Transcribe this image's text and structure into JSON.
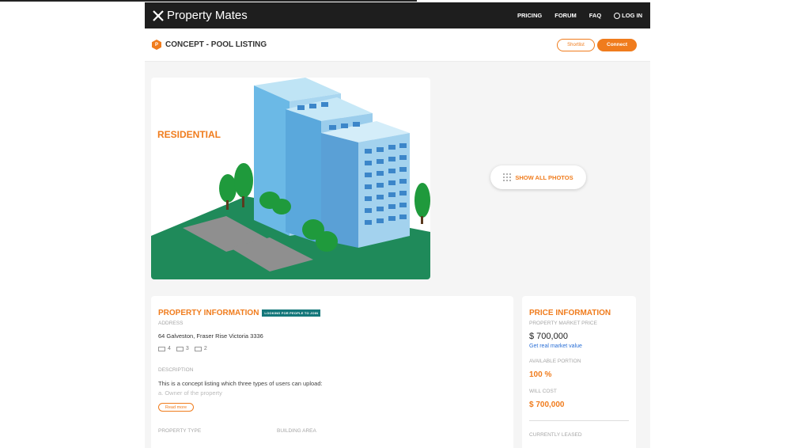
{
  "brand": {
    "name": "Property Mates"
  },
  "nav": {
    "pricing": "PRICING",
    "forum": "FORUM",
    "faq": "FAQ",
    "login": "LOG IN"
  },
  "listing": {
    "hex_letter": "P",
    "title": "CONCEPT - POOL LISTING"
  },
  "actions": {
    "shortlist": "Shortlist",
    "connect": "Connect"
  },
  "photo": {
    "label": "RESIDENTIAL"
  },
  "gallery": {
    "show_all": "SHOW ALL PHOTOS"
  },
  "property": {
    "section_title": "PROPERTY INFORMATION",
    "badge": "LOOKING FOR PEOPLE TO JOIN",
    "address_label": "ADDRESS",
    "address": "64 Galveston, Fraser Rise Victoria 3336",
    "bedrooms": "4",
    "bathrooms": "3",
    "parking": "2",
    "description_label": "DESCRIPTION",
    "description_line1": "This is a concept listing which three types of users can upload:",
    "description_line2": "a. Owner of the property",
    "read_more": "Read more",
    "type_label": "PROPERTY TYPE",
    "area_label": "BUILDING AREA"
  },
  "price": {
    "section_title": "PRICE INFORMATION",
    "market_label": "PROPERTY MARKET PRICE",
    "market_value": "$ 700,000",
    "real_value_link": "Get real market value",
    "portion_label": "AVAILABLE PORTION",
    "portion_value": "100 %",
    "cost_label": "WILL COST",
    "cost_value": "$ 700,000",
    "leased_label": "CURRENTLY LEASED"
  },
  "colors": {
    "accent": "#f07c1d",
    "badge": "#14777a",
    "navbar": "#1e1e1e",
    "link": "#2a6fd6"
  }
}
